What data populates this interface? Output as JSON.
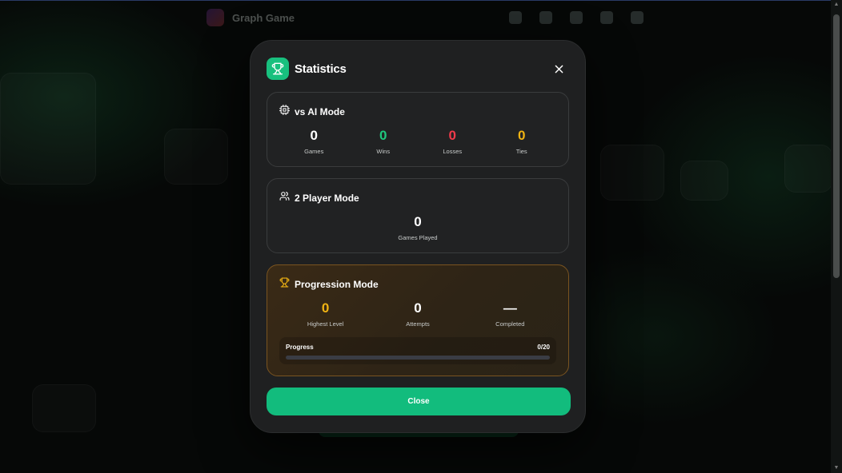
{
  "background": {
    "app_title": "Graph Game"
  },
  "modal": {
    "title": "Statistics",
    "vs_ai": {
      "title": "vs AI Mode",
      "stats": [
        {
          "value": "0",
          "label": "Games",
          "color": "#ffffff"
        },
        {
          "value": "0",
          "label": "Wins",
          "color": "#20c77e"
        },
        {
          "value": "0",
          "label": "Losses",
          "color": "#ef3a4a"
        },
        {
          "value": "0",
          "label": "Ties",
          "color": "#f0b313"
        }
      ]
    },
    "two_player": {
      "title": "2 Player Mode",
      "games_played_value": "0",
      "games_played_label": "Games Played"
    },
    "progression": {
      "title": "Progression Mode",
      "stats": [
        {
          "value": "0",
          "label": "Highest Level",
          "color": "#f0b313"
        },
        {
          "value": "0",
          "label": "Attempts",
          "color": "#ffffff"
        },
        {
          "value": "—",
          "label": "Completed",
          "color": "#ffffff"
        }
      ],
      "progress_label": "Progress",
      "progress_text": "0/20",
      "progress_fraction": 0
    },
    "close_label": "Close"
  },
  "colors": {
    "accent": "#18c07e",
    "progression_border": "#7a5420"
  }
}
